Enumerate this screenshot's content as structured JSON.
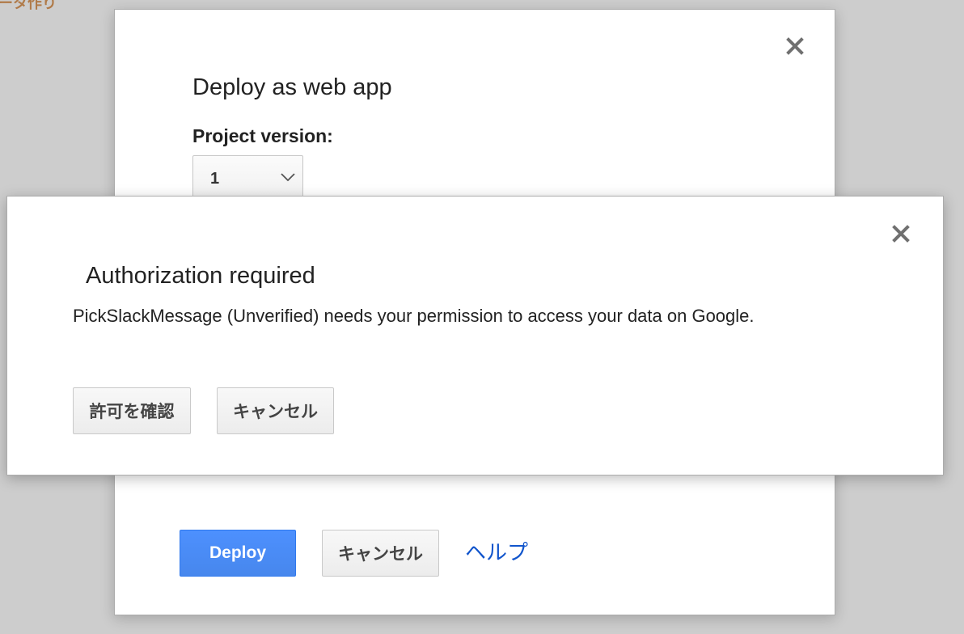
{
  "background": {
    "title_fragment": "ータ作り"
  },
  "deploy_dialog": {
    "title": "Deploy as web app",
    "version_label": "Project version:",
    "version_value": "1",
    "deploy_label": "Deploy",
    "cancel_label": "キャンセル",
    "help_label": "ヘルプ"
  },
  "auth_dialog": {
    "title": "Authorization required",
    "message": "PickSlackMessage (Unverified) needs your permission to access your data on Google.",
    "confirm_label": "許可を確認",
    "cancel_label": "キャンセル"
  },
  "icons": {
    "close": "close-icon",
    "dropdown": "chevron-down-icon"
  },
  "colors": {
    "primary_button": "#4d90fe",
    "link": "#1155cc",
    "overlay": "#cdcdcd"
  }
}
